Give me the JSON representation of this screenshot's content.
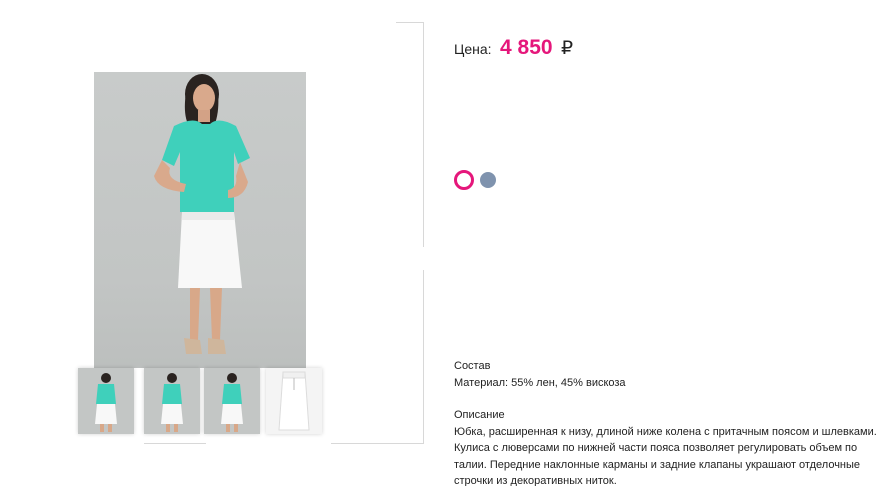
{
  "product": {
    "price_label": "Цена:",
    "price_value": "4 850",
    "currency": "₽"
  },
  "colors": {
    "selected_color": "#e5177b",
    "option_2_color": "#7f93ae"
  },
  "composition": {
    "title": "Состав",
    "material": "Материал: 55% лен, 45% вискоза"
  },
  "description": {
    "title": "Описание",
    "text": "Юбка, расширенная к низу, длиной ниже колена с притачным поясом и шлевками. Кулиса с люверсами по нижней части пояса позволяет регулировать объем по талии.  Передние наклонные карманы и задние клапаны украшают отделочные строчки из декоративных ниток."
  },
  "gallery": {
    "main_image": "model-photo",
    "thumbnails": [
      "thumb-model-1",
      "thumb-model-2",
      "thumb-model-3",
      "thumb-skirt-flat"
    ]
  }
}
